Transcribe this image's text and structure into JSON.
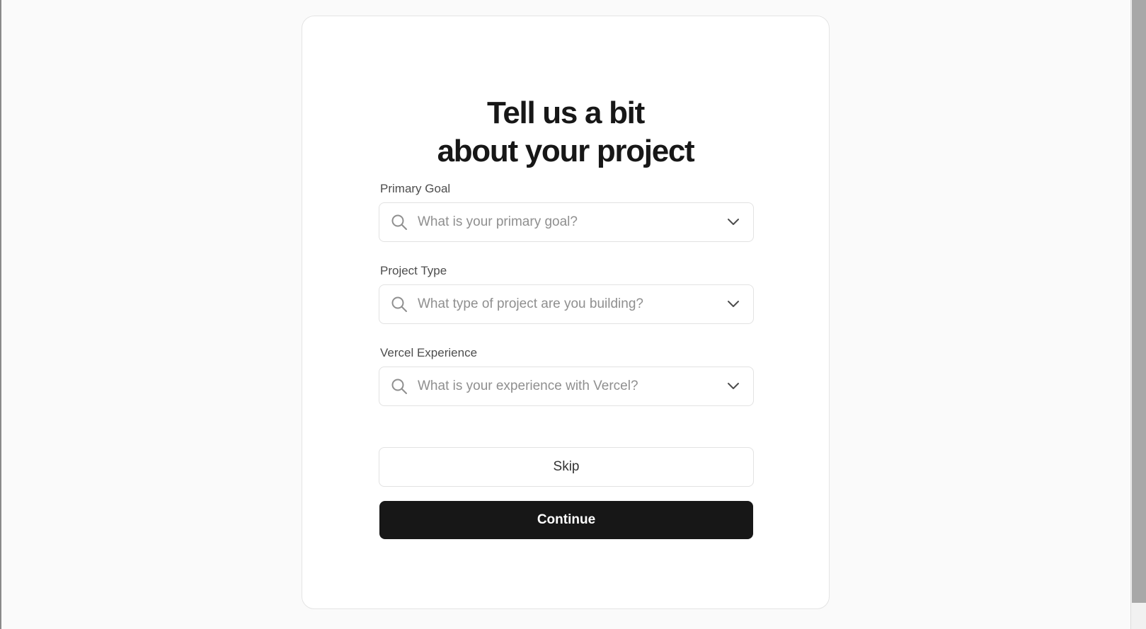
{
  "form": {
    "title_line1": "Tell us a bit",
    "title_line2": "about your project",
    "fields": [
      {
        "label": "Primary Goal",
        "placeholder": "What is your primary goal?",
        "value": ""
      },
      {
        "label": "Project Type",
        "placeholder": "What type of project are you building?",
        "value": ""
      },
      {
        "label": "Vercel Experience",
        "placeholder": "What is your experience with Vercel?",
        "value": ""
      }
    ],
    "skip_label": "Skip",
    "continue_label": "Continue"
  },
  "icons": {
    "field_leading": "search-icon",
    "field_trailing": "chevron-down-icon"
  },
  "colors": {
    "primary_button": "#171717",
    "page_background": "#fafafa",
    "card_background": "#ffffff"
  }
}
